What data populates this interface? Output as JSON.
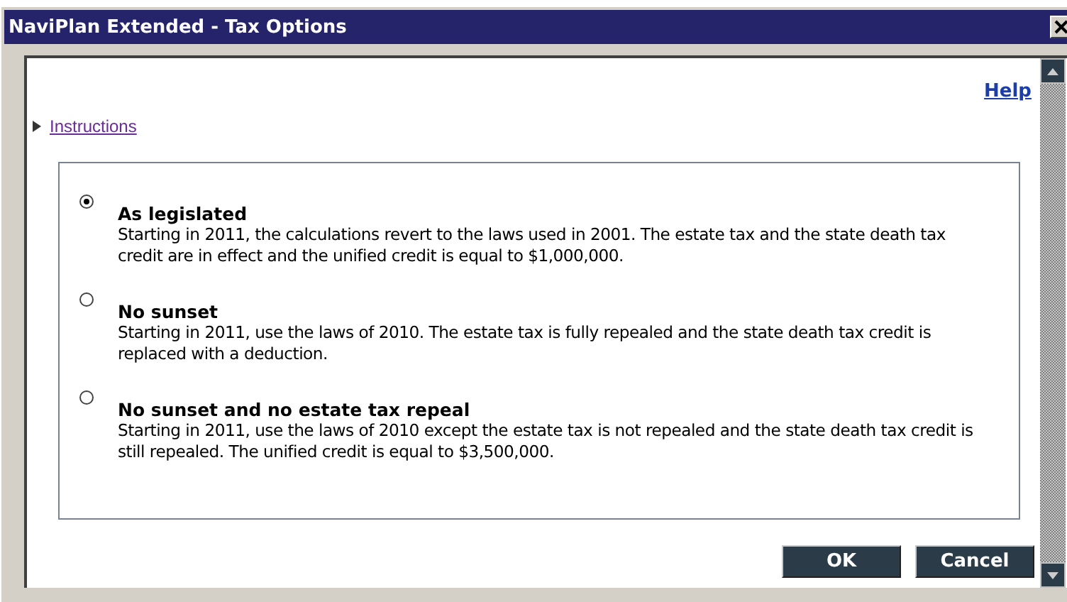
{
  "window": {
    "title": "NaviPlan Extended - Tax Options"
  },
  "help_link": "Help",
  "instructions": {
    "label": "Instructions",
    "expanded": false
  },
  "options": [
    {
      "title": "As legislated",
      "description": "Starting in 2011, the calculations revert to the laws used in 2001. The estate tax and the state death tax credit are in effect and the unified credit is equal to $1,000,000.",
      "selected": true
    },
    {
      "title": "No sunset",
      "description": "Starting in 2011, use the laws of 2010. The estate tax is fully repealed and the state death tax credit is replaced with a deduction.",
      "selected": false
    },
    {
      "title": "No sunset and no estate tax repeal",
      "description": "Starting in 2011, use the laws of 2010 except the estate tax is not repealed and the state death tax credit is still repealed. The unified credit is equal to $3,500,000.",
      "selected": false
    }
  ],
  "buttons": [
    "OK",
    "Cancel"
  ]
}
